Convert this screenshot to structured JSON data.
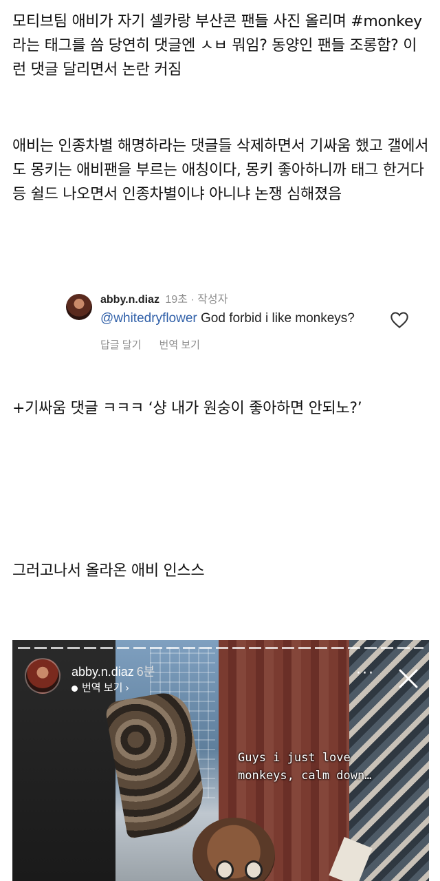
{
  "post": {
    "paragraph1": "모티브팀 애비가 자기 셀카랑 부산콘 팬들 사진 올리며 #monkey라는 태그를 씀 당연히 댓글엔 ㅅㅂ 뭐임? 동양인 팬들 조롱함? 이런 댓글 달리면서 논란 커짐",
    "paragraph2": "애비는 인종차별 해명하라는 댓글들 삭제하면서 기싸움 했고 갤에서도 몽키는 애비팬을 부르는 애칭이다, 몽키 좋아하니까 태그 한거다 등 쉴드 나오면서 인종차별이냐 아니냐 논쟁 심해졌음",
    "paragraph3": "+기싸움 댓글 ㅋㅋㅋ ‘샹 내가 원숭이 좋아하면 안되노?’",
    "paragraph4": "그러고나서 올라온 애비 인스스"
  },
  "comment": {
    "username": "abby.n.diaz",
    "meta": "19초 · 작성자",
    "mention": "@whitedryflower",
    "text": " God forbid i like monkeys?",
    "reply_label": "답글 달기",
    "translate_label": "번역 보기",
    "heart_icon": "heart-outline-icon"
  },
  "story": {
    "username": "abby.n.diaz",
    "time": "6분",
    "translate_label": "번역 보기 ›",
    "more_label": "···",
    "caption_line1": "Guys i just love",
    "caption_line2": "monkeys, calm down…",
    "close_icon": "close-x-icon"
  }
}
